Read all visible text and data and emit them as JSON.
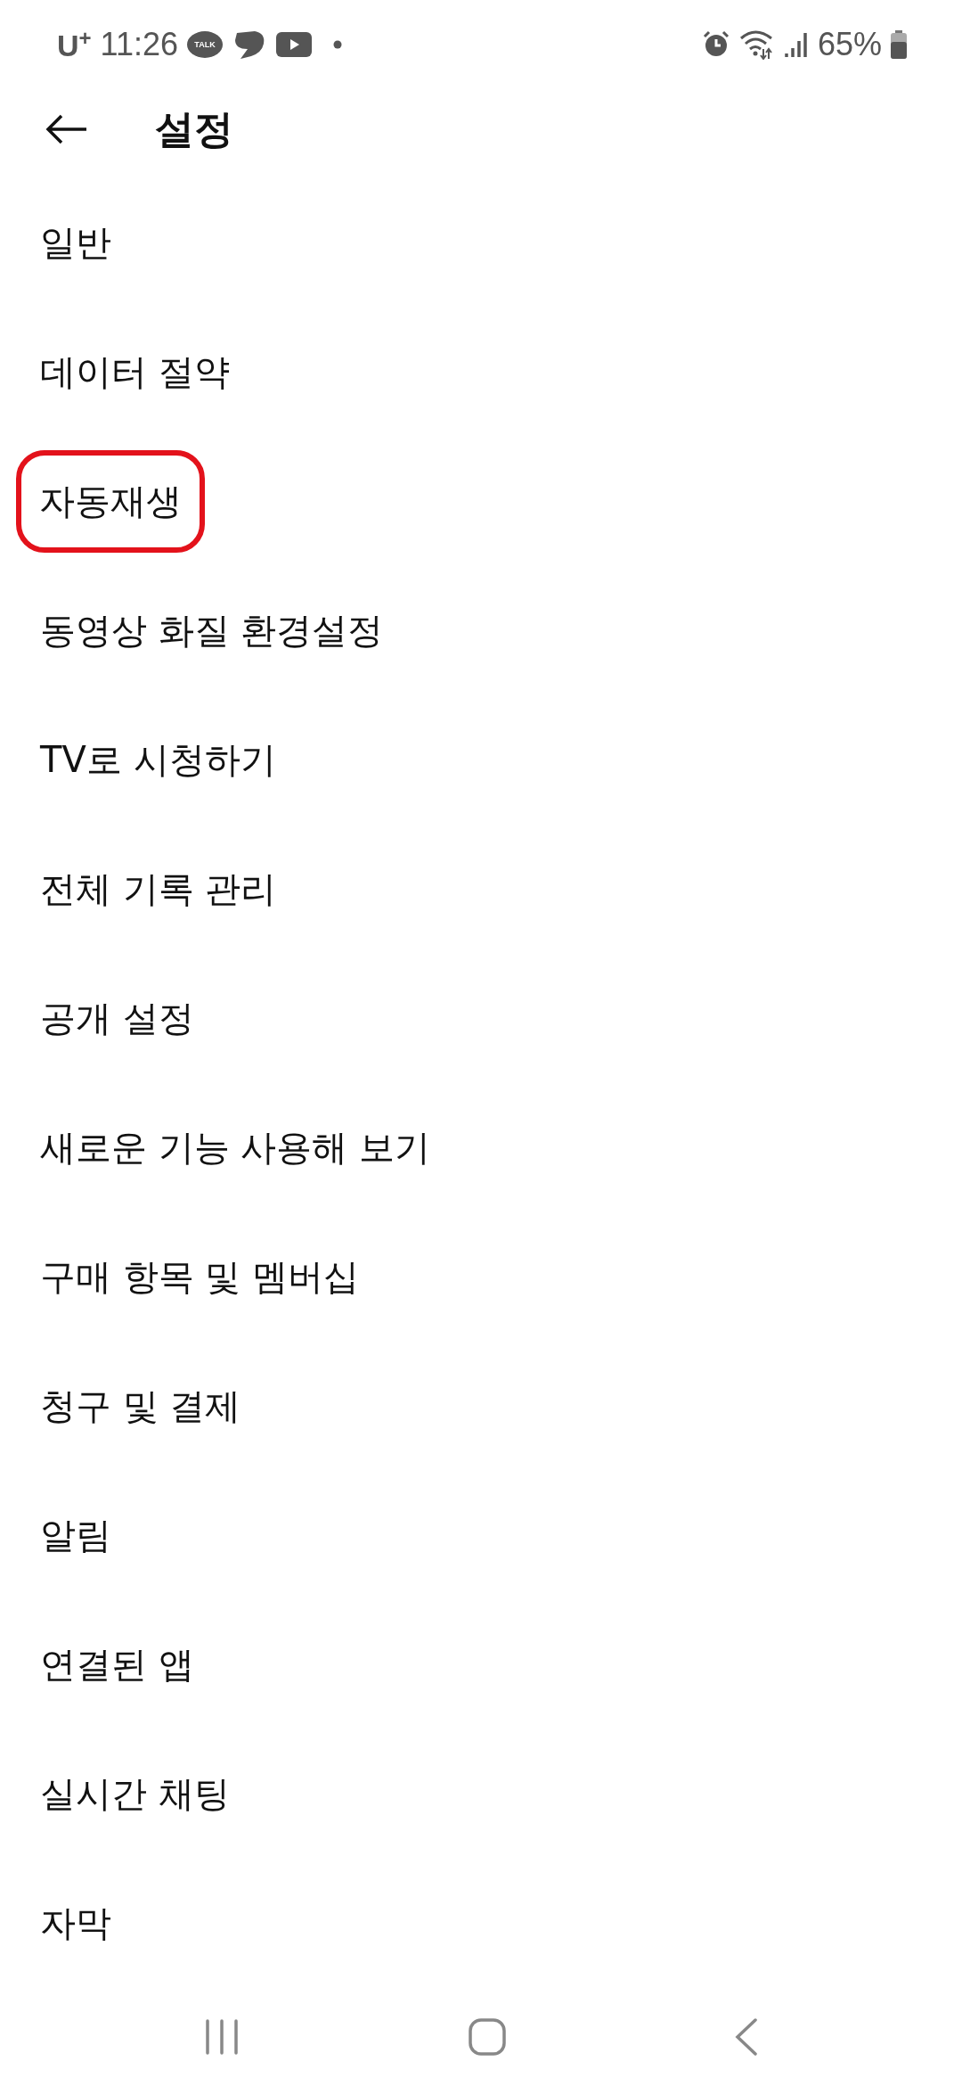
{
  "status_bar": {
    "carrier": "U$^{+}$",
    "time": "11:26",
    "talk_badge": "TALK",
    "battery": "65%"
  },
  "header": {
    "title": "설정"
  },
  "items": [
    {
      "label": "일반",
      "highlighted": false
    },
    {
      "label": "데이터 절약",
      "highlighted": false
    },
    {
      "label": "자동재생",
      "highlighted": true
    },
    {
      "label": "동영상 화질 환경설정",
      "highlighted": false
    },
    {
      "label": "TV로 시청하기",
      "highlighted": false
    },
    {
      "label": "전체 기록 관리",
      "highlighted": false
    },
    {
      "label": "공개 설정",
      "highlighted": false
    },
    {
      "label": "새로운 기능 사용해 보기",
      "highlighted": false
    },
    {
      "label": "구매 항목 및 멤버십",
      "highlighted": false
    },
    {
      "label": "청구 및 결제",
      "highlighted": false
    },
    {
      "label": "알림",
      "highlighted": false
    },
    {
      "label": "연결된 앱",
      "highlighted": false
    },
    {
      "label": "실시간 채팅",
      "highlighted": false
    },
    {
      "label": "자막",
      "highlighted": false
    }
  ]
}
